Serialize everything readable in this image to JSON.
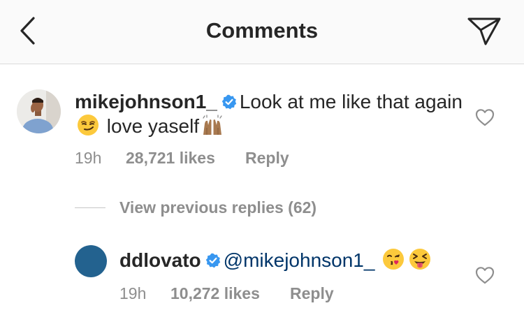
{
  "header": {
    "title": "Comments",
    "back_icon": "chevron-left-icon",
    "share_icon": "paper-plane-icon"
  },
  "comment": {
    "username": "mikejohnson1_",
    "verified": true,
    "text_part1": "Look at me like that again",
    "emoji1": "smirking-face-emoji",
    "text_part2": "love yaself",
    "emoji2": "raising-hands-emoji",
    "time": "19h",
    "likes": "28,721 likes",
    "reply_label": "Reply"
  },
  "replies_toggle": {
    "label": "View previous replies (62)"
  },
  "reply": {
    "username": "ddlovato",
    "verified": true,
    "mention": "@mikejohnson1_",
    "emoji1": "face-blowing-kiss-emoji",
    "emoji2": "squinting-face-with-tongue-emoji",
    "time": "19h",
    "likes": "10,272 likes",
    "reply_label": "Reply"
  },
  "colors": {
    "verified_badge": "#3897f0",
    "muted_text": "#8e8e8e",
    "avatar_reply_bg": "#23628f"
  }
}
